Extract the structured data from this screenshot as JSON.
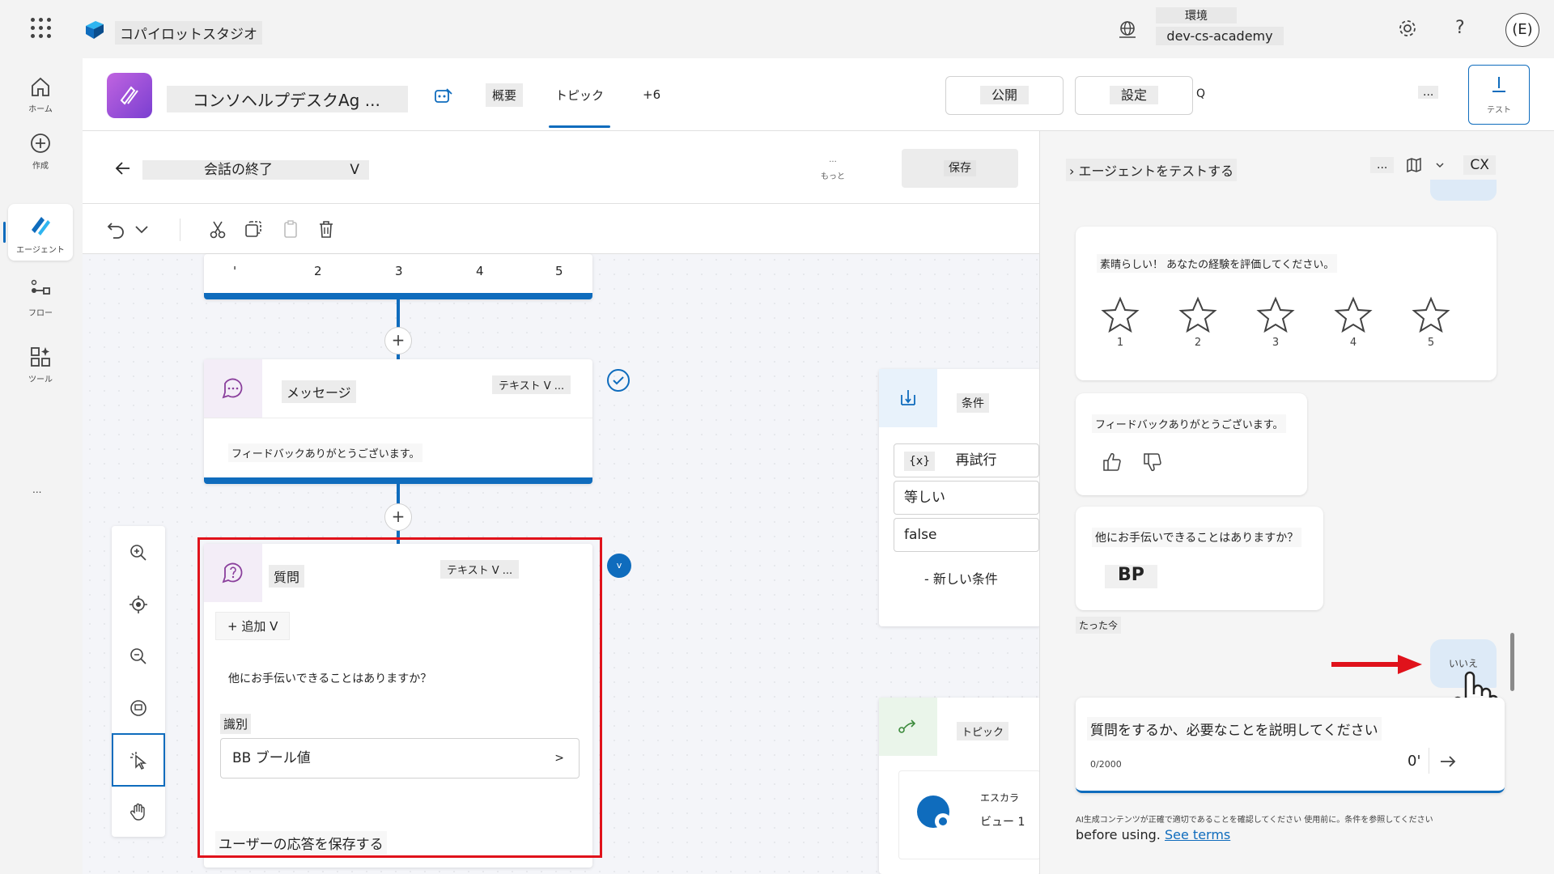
{
  "app": {
    "name": "コパイロットスタジオ"
  },
  "environment": {
    "label": "環境",
    "value": "dev-cs-academy"
  },
  "account": {
    "initials": "(E)"
  },
  "topbar": {
    "help": "?"
  },
  "nav": {
    "items": [
      {
        "label": "ホーム",
        "icon": "home-icon"
      },
      {
        "label": "作成",
        "icon": "create-icon"
      },
      {
        "label": "エージェント",
        "icon": "agents-icon"
      },
      {
        "label": "フロー",
        "icon": "flows-icon"
      },
      {
        "label": "ツール",
        "icon": "tools-icon"
      }
    ],
    "more": "..."
  },
  "agent": {
    "name": "コンソヘルプデスクAg ...",
    "tabs": {
      "overview": "概要",
      "topics": "トピック",
      "more": "+6"
    },
    "search": "Q",
    "publish": "公開",
    "settings": "設定",
    "more": "...",
    "test": "テスト"
  },
  "topic": {
    "name": "会話の終了",
    "chevron": "V",
    "more_dots": "...",
    "more_label": "もっと",
    "save": "保存"
  },
  "canvas": {
    "rating_numbers": [
      "'",
      "2",
      "3",
      "4",
      "5"
    ],
    "message_node": {
      "title": "メッセージ",
      "type": "テキスト V ...",
      "text": "フィードバックありがとうございます。"
    },
    "question_node": {
      "title": "質問",
      "type": "テキスト V ...",
      "add": "+ 追加 V",
      "text": "他にお手伝いできることはありますか？",
      "identify_label": "識別",
      "identify_value": "BB ブール値",
      "identify_chevron": ">",
      "save_response": "ユーザーの応答を保存する",
      "badge": "v"
    },
    "condition_node": {
      "title": "条件",
      "variable": "再試行",
      "variable_icon": "{x}",
      "operator": "等しい",
      "value": "false",
      "new_condition": "- 新しい条件"
    },
    "topic_node": {
      "title": "トピック",
      "escalate_line1": "エスカラ",
      "escalate_line2": "ビュー 1"
    }
  },
  "test_panel": {
    "title": "› エージェントをテストする",
    "more": "...",
    "close_label": "CX",
    "rating_card": {
      "text": "素晴らしい！ あなたの経験を評価してください。",
      "stars": [
        "1",
        "2",
        "3",
        "4",
        "5"
      ]
    },
    "thanks_card": {
      "text": "フィードバックありがとうございます。"
    },
    "question_card": {
      "text": "他にお手伝いできることはありますか？",
      "choice": "BP"
    },
    "timestamp": "たった今",
    "user_reply": "いいえ",
    "input": {
      "placeholder": "質問をするか、必要なことを説明してください",
      "char_count": "0/2000"
    },
    "disclaimer": "AI生成コンテンツが正確で適切であることを確認してください 使用前に。条件を参照してください",
    "before_using": "before using.",
    "see_terms": "See terms"
  },
  "colors": {
    "accent": "#0f6cbd",
    "highlight_red": "#e0121b",
    "agent_icon": "#9b4fd9"
  }
}
